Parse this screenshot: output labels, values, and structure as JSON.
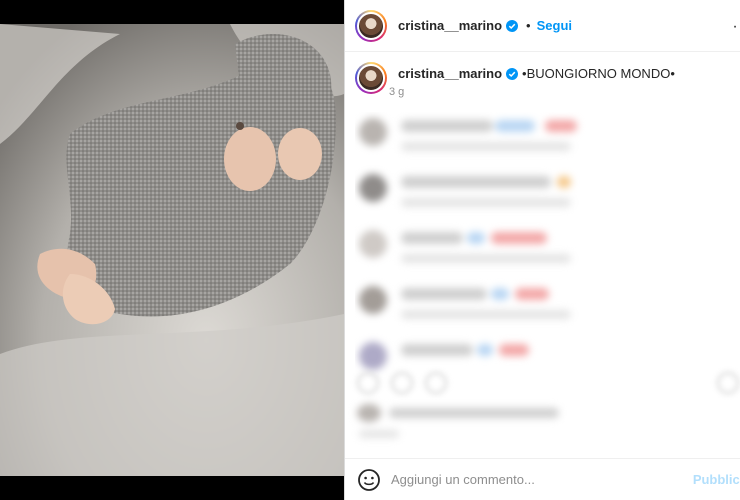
{
  "post": {
    "username": "cristina__marino",
    "follow_label": "Segui",
    "separator": "•",
    "more_label": "··",
    "caption": "•BUONGIORNO MONDO•",
    "time_ago": "3 g"
  },
  "comment_box": {
    "placeholder": "Aggiungi un commento...",
    "publish_label": "Pubblica"
  },
  "colors": {
    "accent": "#0095f6",
    "text": "#262626",
    "muted": "#8e8e8e",
    "publish_disabled": "#b2dffc"
  },
  "icons": {
    "verified": "verified-badge-icon",
    "emoji": "smiley-face-icon",
    "more": "more-options-icon"
  }
}
